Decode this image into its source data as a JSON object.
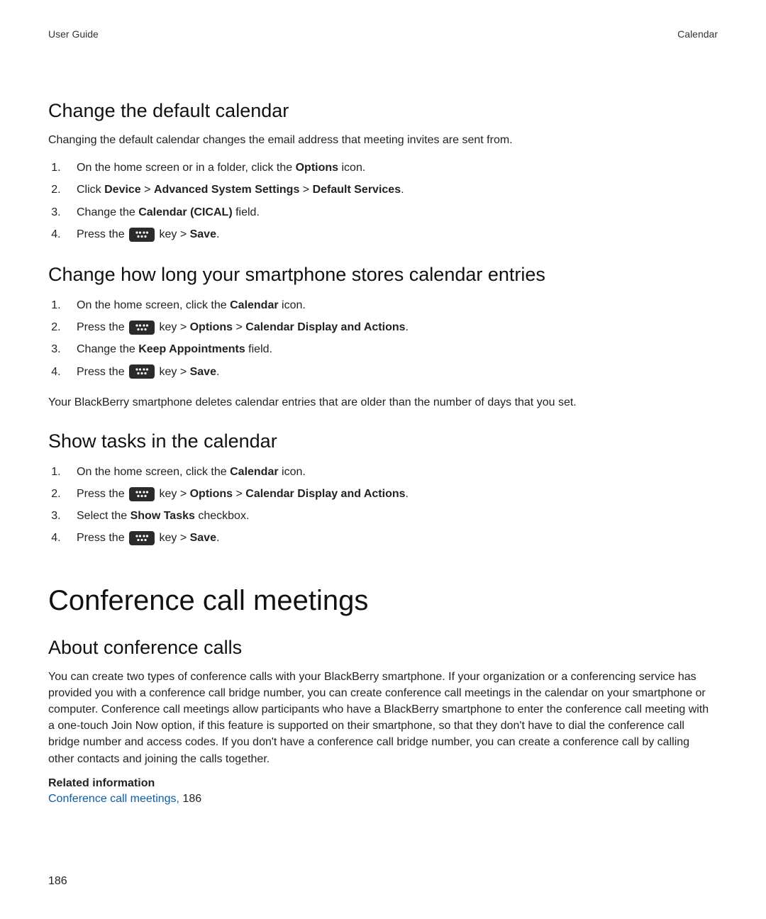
{
  "header": {
    "left": "User Guide",
    "right": "Calendar"
  },
  "sections": {
    "s1": {
      "title": "Change the default calendar",
      "intro": "Changing the default calendar changes the email address that meeting invites are sent from.",
      "step1_a": "On the home screen or in a folder, click the ",
      "step1_b": "Options",
      "step1_c": " icon.",
      "step2_a": "Click ",
      "step2_b": "Device",
      "step2_c": " > ",
      "step2_d": "Advanced System Settings",
      "step2_e": " > ",
      "step2_f": "Default Services",
      "step2_g": ".",
      "step3_a": "Change the ",
      "step3_b": "Calendar (CICAL)",
      "step3_c": " field.",
      "step4_a": "Press the ",
      "step4_b": " key > ",
      "step4_c": "Save",
      "step4_d": "."
    },
    "s2": {
      "title": "Change how long your smartphone stores calendar entries",
      "step1_a": "On the home screen, click the ",
      "step1_b": "Calendar",
      "step1_c": " icon.",
      "step2_a": "Press the ",
      "step2_b": " key > ",
      "step2_c": "Options",
      "step2_d": " > ",
      "step2_e": "Calendar Display and Actions",
      "step2_f": ".",
      "step3_a": "Change the ",
      "step3_b": "Keep Appointments",
      "step3_c": " field.",
      "step4_a": "Press the ",
      "step4_b": " key > ",
      "step4_c": "Save",
      "step4_d": ".",
      "note": "Your BlackBerry smartphone deletes calendar entries that are older than the number of days that you set."
    },
    "s3": {
      "title": "Show tasks in the calendar",
      "step1_a": "On the home screen, click the ",
      "step1_b": "Calendar",
      "step1_c": " icon.",
      "step2_a": "Press the ",
      "step2_b": " key > ",
      "step2_c": "Options",
      "step2_d": " > ",
      "step2_e": "Calendar Display and Actions",
      "step2_f": ".",
      "step3_a": "Select the ",
      "step3_b": "Show Tasks",
      "step3_c": " checkbox.",
      "step4_a": "Press the ",
      "step4_b": " key > ",
      "step4_c": "Save",
      "step4_d": "."
    },
    "big": {
      "title": "Conference call meetings"
    },
    "s4": {
      "title": "About conference calls",
      "body": "You can create two types of conference calls with your BlackBerry smartphone. If your organization or a conferencing service has provided you with a conference call bridge number, you can create conference call meetings in the calendar on your smartphone or computer. Conference call meetings allow participants who have a BlackBerry smartphone to enter the conference call meeting with a one-touch Join Now option, if this feature is supported on their smartphone, so that they don't have to dial the conference call bridge number and access codes. If you don't have a conference call bridge number, you can create a conference call by calling other contacts and joining the calls together.",
      "related_label": "Related information",
      "link_text": "Conference call meetings,",
      "link_page": " 186"
    }
  },
  "page_number": "186"
}
